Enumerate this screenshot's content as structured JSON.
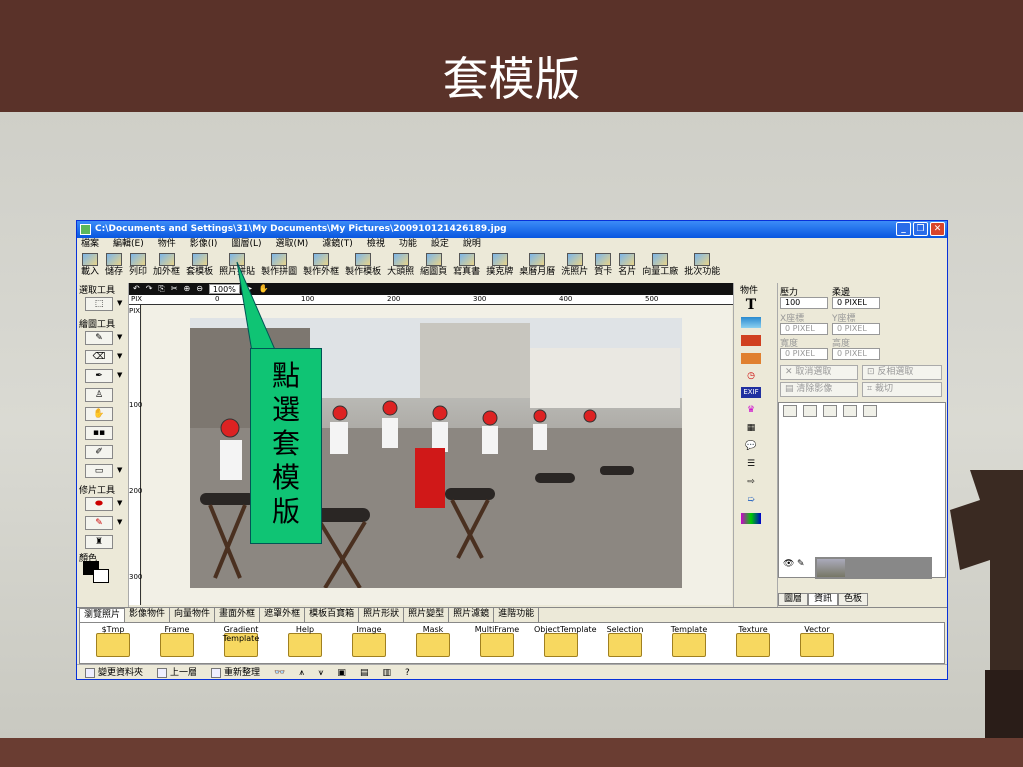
{
  "slide": {
    "title": "套模版",
    "callout_chars": [
      "點",
      "選",
      "套",
      "模",
      "版"
    ]
  },
  "window": {
    "title": "C:\\Documents and Settings\\31\\My Documents\\My Pictures\\200910121426189.jpg",
    "buttons": [
      "_",
      "❐",
      "✕"
    ]
  },
  "menu": [
    "檔案",
    "編輯(E)",
    "物件",
    "影像(I)",
    "圖層(L)",
    "選取(M)",
    "濾鏡(T)",
    "檢視",
    "功能",
    "設定",
    "說明"
  ],
  "toolbar": [
    "載入",
    "儲存",
    "列印",
    "加外框",
    "套模板",
    "照片拼貼",
    "製作拼圖",
    "製作外框",
    "製作模板",
    "大頭照",
    "縮圖頁",
    "寫真書",
    "撲克牌",
    "桌曆月曆",
    "洗照片",
    "賀卡",
    "名片",
    "向量工廠",
    "批次功能"
  ],
  "left_panel": {
    "select_label": "選取工具",
    "draw_label": "繪圖工具",
    "retouch_label": "修片工具",
    "color_label": "顏色"
  },
  "canvas_bar": {
    "zoom": "100%"
  },
  "ruler": {
    "top_ticks": [
      "PIX",
      "0",
      "100",
      "200",
      "300",
      "400",
      "500"
    ],
    "left_ticks": [
      "PIX",
      "100",
      "200",
      "300"
    ]
  },
  "objects": {
    "label": "物件",
    "items": [
      "T",
      "EXIF"
    ]
  },
  "properties": {
    "pressure_label": "壓力",
    "soft_label": "柔邊",
    "pressure_value": "100",
    "soft_value": "0 PIXEL",
    "x_label": "X座標",
    "y_label": "Y座標",
    "x_value": "0 PIXEL",
    "y_value": "0 PIXEL",
    "w_label": "寬度",
    "h_label": "高度",
    "w_value": "0 PIXEL",
    "h_value": "0 PIXEL",
    "cancel_select": "取消選取",
    "invert_select": "反相選取",
    "clear_image": "清除影像",
    "crop": "裁切"
  },
  "prop_tabs": [
    "圖層",
    "資訊",
    "色板"
  ],
  "browser_tabs": [
    "瀏覽照片",
    "影像物件",
    "向量物件",
    "畫面外框",
    "遮罩外框",
    "模板百寶箱",
    "照片形狀",
    "照片變型",
    "照片濾鏡",
    "進階功能"
  ],
  "folders": [
    "$Tmp",
    "Frame",
    "Gradient Template",
    "Help",
    "Image",
    "Mask",
    "MultiFrame",
    "ObjectTemplate",
    "Selection",
    "Template",
    "Texture",
    "Vector"
  ],
  "status": [
    "變更資料夾",
    "上一層",
    "重新整理",
    "?"
  ]
}
